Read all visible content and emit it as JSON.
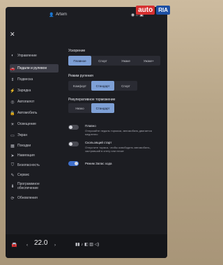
{
  "topbar": {
    "profile_name": "Artem",
    "status_right": "◉ ⌂ ▣"
  },
  "sidebar": {
    "items": [
      {
        "icon": "toggle-icon",
        "glyph": "◐",
        "label": "Управление"
      },
      {
        "icon": "car-icon",
        "glyph": "🚗",
        "label": "Педали и рулевое"
      },
      {
        "icon": "suspension-icon",
        "glyph": "⇕",
        "label": "Подвеска"
      },
      {
        "icon": "charging-icon",
        "glyph": "⚡",
        "label": "Зарядка"
      },
      {
        "icon": "steering-wheel-icon",
        "glyph": "◎",
        "label": "Автопилот"
      },
      {
        "icon": "lock-icon",
        "glyph": "🔒",
        "label": "Автомобиль"
      },
      {
        "icon": "bulb-icon",
        "glyph": "☀",
        "label": "Освещение"
      },
      {
        "icon": "screen-icon",
        "glyph": "▭",
        "label": "Экран"
      },
      {
        "icon": "calendar-icon",
        "glyph": "▦",
        "label": "Поездки"
      },
      {
        "icon": "navigation-icon",
        "glyph": "➤",
        "label": "Навигация"
      },
      {
        "icon": "shield-icon",
        "glyph": "⛉",
        "label": "Безопасность"
      },
      {
        "icon": "wrench-icon",
        "glyph": "✎",
        "label": "Сервис"
      },
      {
        "icon": "download-icon",
        "glyph": "⬇",
        "label": "Программное обеспечение"
      },
      {
        "icon": "refresh-icon",
        "glyph": "⟳",
        "label": "Обновления"
      }
    ]
  },
  "main": {
    "acceleration": {
      "title": "Ускорение",
      "options": [
        "Плавное",
        "Спорт",
        "Ужаке",
        "Ужаке+"
      ]
    },
    "steering": {
      "title": "Режим руления",
      "options": [
        "Комфорт",
        "Стандарт",
        "Спорт"
      ]
    },
    "regen": {
      "title": "Рекуперативное торможение",
      "options": [
        "Низко",
        "Стандарт"
      ]
    },
    "smooth_stop": {
      "label": "Плавно",
      "desc": "Отпускайте педаль тормоза, автомобиль двигается медленно",
      "state": "off"
    },
    "rolling": {
      "label": "Скользящий старт",
      "desc": "Отпустите тормоз, чтобы освободить автомобиль, застрявший в снегу или песке",
      "state": "off"
    },
    "hold": {
      "label": "Режим Запас хода",
      "state": "on"
    }
  },
  "bottombar": {
    "temperature": "22.0",
    "left_icon": "car-icon",
    "right_icons": "▮▮  ♪  ◧  ▥  ◁)"
  },
  "watermark": {
    "auto": "auto",
    "ria": "RIA"
  },
  "colors": {
    "accent": "#7ea0d6",
    "toggle_on": "#3d6fcc",
    "background": "#1c1d22"
  }
}
